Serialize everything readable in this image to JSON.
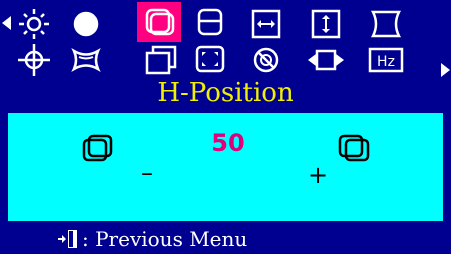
{
  "osd": {
    "title": "H-Position",
    "value": "50",
    "minus": "–",
    "plus": "+",
    "footer_label": ": Previous Menu",
    "selected_icon": "h-position",
    "menu_icons_row1": [
      "brightness",
      "contrast",
      "h-position",
      "v-position",
      "h-size",
      "v-size",
      "pincushion"
    ],
    "menu_icons_row2": [
      "rotation",
      "trapezoid",
      "parallelogram",
      "zoom",
      "degauss",
      "moire",
      "frequency"
    ]
  },
  "colors": {
    "background": "#000090",
    "title": "#f0f000",
    "panel": "#00ffff",
    "value": "#e0007c",
    "selected": "#ff0080",
    "icon": "#ffffff"
  }
}
